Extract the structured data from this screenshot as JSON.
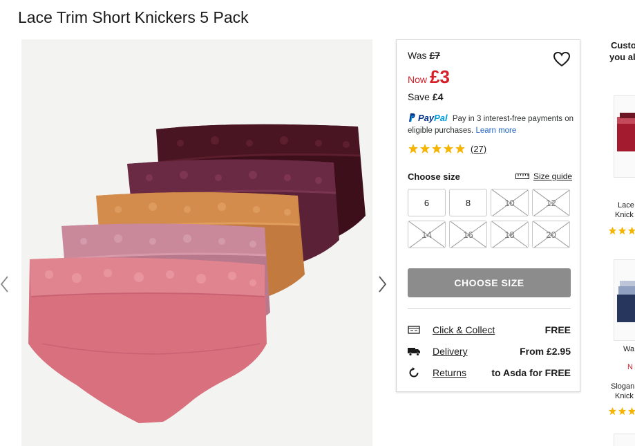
{
  "product": {
    "title": "Lace Trim Short Knickers 5 Pack"
  },
  "pricing": {
    "was_label": "Was",
    "was_price": "£7",
    "now_label": "Now",
    "now_price": "£3",
    "save_label": "Save",
    "save_amount": "£4"
  },
  "paypal": {
    "logo_pay": "Pay",
    "logo_pal": "Pal",
    "text": "Pay in 3 interest-free payments on eligible purchases.",
    "link": "Learn more"
  },
  "rating": {
    "stars": 5,
    "count": "(27)"
  },
  "size": {
    "heading": "Choose size",
    "guide_label": "Size guide",
    "options": [
      {
        "label": "6",
        "available": true
      },
      {
        "label": "8",
        "available": true
      },
      {
        "label": "10",
        "available": false
      },
      {
        "label": "12",
        "available": false
      },
      {
        "label": "14",
        "available": false
      },
      {
        "label": "16",
        "available": false
      },
      {
        "label": "18",
        "available": false
      },
      {
        "label": "20",
        "available": false
      }
    ],
    "button_label": "CHOOSE SIZE"
  },
  "delivery": {
    "click_collect": {
      "label": "Click & Collect",
      "value": "FREE"
    },
    "home": {
      "label": "Delivery",
      "value": "From £2.95"
    },
    "returns": {
      "label": "Returns",
      "value": "to Asda for FREE"
    }
  },
  "rail": {
    "heading_line1": "Custo",
    "heading_line2": "you al",
    "item1_line1": "Lace",
    "item1_line2": "Knick",
    "item2_line1": "Wa",
    "item2_line2": "N",
    "item3_line1": "Slogan",
    "item3_line2": "Knick"
  },
  "colors": {
    "price_red": "#d4202a",
    "star_gold": "#f5b400",
    "button_grey": "#8c8c8c",
    "paypal_blue": "#003087",
    "paypal_light_blue": "#009cde",
    "link_blue": "#1f62c6"
  }
}
